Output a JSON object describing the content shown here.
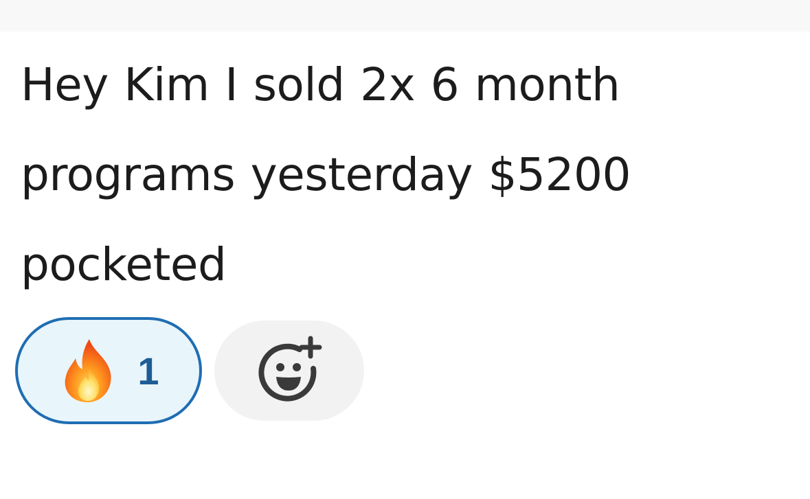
{
  "message": {
    "text": "Hey Kim I sold 2x 6 month programs yesterday $5200 pocketed"
  },
  "reactions": [
    {
      "emoji_icon": "fire-icon",
      "count": "1",
      "selected": true
    }
  ],
  "add_reaction": {
    "icon": "add-emoji-icon"
  },
  "colors": {
    "text": "#1d1c1d",
    "reaction_border": "#1f6db3",
    "reaction_bg": "#e8f5fa",
    "reaction_count": "#1d5c95",
    "add_reaction_bg": "#f2f2f2",
    "icon": "#3a3a3a"
  }
}
